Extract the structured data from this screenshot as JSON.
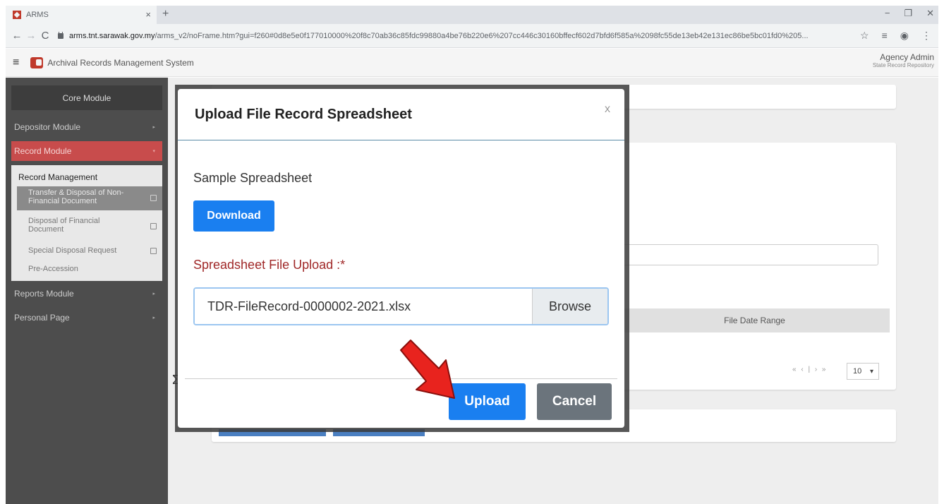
{
  "browser": {
    "tab_title": "ARMS",
    "tab_close": "×",
    "new_tab": "+",
    "url_host": "arms.tnt.sarawak.gov.my",
    "url_path": "/arms_v2/noFrame.htm?gui=f260#0d8e5e0f177010000%20f8c70ab36c85fdc99880a4be76b220e6%207cc446c30160bffecf602d7bfd6f585a%2098fc55de13eb42e131ec86be5bc01fd0%205...",
    "win_minimize": "−",
    "win_restore": "❐",
    "win_close": "✕",
    "back": "←",
    "forward": "→",
    "reload": "C",
    "star": "☆",
    "reading_list": "≡",
    "profile": "◉",
    "menu": "⋮"
  },
  "header": {
    "menu_glyph": "≡",
    "app_title": "Archival Records Management System",
    "user_name": "Agency Admin",
    "user_org": "State Record Repository"
  },
  "sidebar": {
    "core_module": "Core Module",
    "depositor_module": "Depositor Module",
    "record_module": "Record Module",
    "submenu_heading": "Record Management",
    "sub_items": [
      {
        "label_1": "Transfer & Disposal of Non-",
        "label_2": "Financial Document"
      },
      {
        "label_1": "Disposal of Financial",
        "label_2": "Document"
      },
      {
        "label_1": "Special Disposal Request"
      },
      {
        "label_1": "Pre-Accession"
      }
    ],
    "reports_module": "Reports Module",
    "personal_page": "Personal Page",
    "caret_right": "▸",
    "caret_down": "▾"
  },
  "background": {
    "table_header_file_date_range": "File Date Range",
    "pager": "« ‹ | › »",
    "page_size": "10",
    "glyph": "Σ"
  },
  "modal": {
    "title": "Upload File Record Spreadsheet",
    "close": "x",
    "sample_label": "Sample Spreadsheet",
    "download_button": "Download",
    "upload_label": "Spreadsheet File Upload :*",
    "file_value": "TDR-FileRecord-0000002-2021.xlsx",
    "browse_button": "Browse",
    "upload_button": "Upload",
    "cancel_button": "Cancel"
  },
  "annotation": {
    "arrow_color": "#e8231e"
  }
}
